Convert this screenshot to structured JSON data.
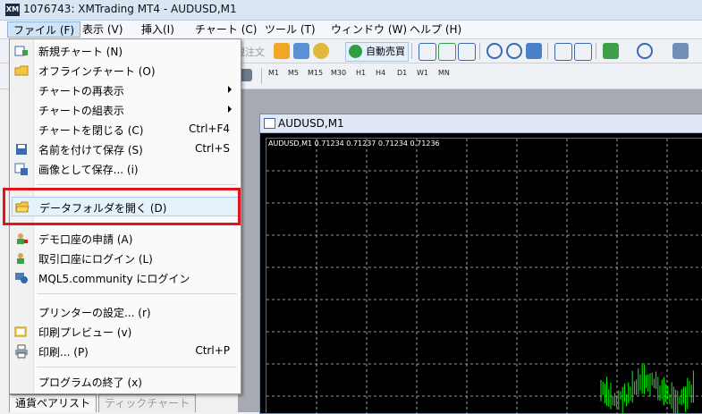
{
  "window": {
    "title": "1076743: XMTrading MT4 - AUDUSD,M1",
    "logo": "XM"
  },
  "menubar": {
    "items": [
      "ファイル (F)",
      "表示 (V)",
      "挿入(I)",
      "チャート (C)",
      "ツール (T)",
      "ウィンドウ (W)",
      "ヘルプ (H)"
    ]
  },
  "toolbar": {
    "new_order_label": "規注文",
    "autotrade_label": "自動売買",
    "timeframes": [
      "M1",
      "M5",
      "M15",
      "M30",
      "H1",
      "H4",
      "D1",
      "W1",
      "MN"
    ]
  },
  "file_menu": {
    "items": [
      {
        "label": "新規チャート (N)",
        "icon": "new-chart-icon",
        "shortcut": "",
        "submenu": false
      },
      {
        "label": "オフラインチャート (O)",
        "icon": "offline-chart-icon",
        "shortcut": "",
        "submenu": false
      },
      {
        "label": "チャートの再表示",
        "icon": "",
        "shortcut": "",
        "submenu": true
      },
      {
        "label": "チャートの組表示",
        "icon": "",
        "shortcut": "",
        "submenu": true
      },
      {
        "label": "チャートを閉じる (C)",
        "icon": "",
        "shortcut": "Ctrl+F4",
        "submenu": false
      },
      {
        "label": "名前を付けて保存 (S)",
        "icon": "save-icon",
        "shortcut": "Ctrl+S",
        "submenu": false
      },
      {
        "label": "画像として保存... (i)",
        "icon": "save-image-icon",
        "shortcut": "",
        "submenu": false
      },
      {
        "label": "データフォルダを開く (D)",
        "icon": "open-folder-icon",
        "shortcut": "",
        "submenu": false
      },
      {
        "label": "デモ口座の申請 (A)",
        "icon": "demo-account-icon",
        "shortcut": "",
        "submenu": false
      },
      {
        "label": "取引口座にログイン (L)",
        "icon": "login-account-icon",
        "shortcut": "",
        "submenu": false
      },
      {
        "label": "MQL5.community にログイン",
        "icon": "mql5-login-icon",
        "shortcut": "",
        "submenu": false
      },
      {
        "label": "プリンターの設定... (r)",
        "icon": "",
        "shortcut": "",
        "submenu": false
      },
      {
        "label": "印刷プレビュー (v)",
        "icon": "print-preview-icon",
        "shortcut": "",
        "submenu": false
      },
      {
        "label": "印刷... (P)",
        "icon": "print-icon",
        "shortcut": "Ctrl+P",
        "submenu": false
      },
      {
        "label": "プログラムの終了 (x)",
        "icon": "",
        "shortcut": "",
        "submenu": false
      }
    ]
  },
  "chart": {
    "window_title": "AUDUSD,M1",
    "info": "AUDUSD,M1  0.71234 0.71237 0.71234 0.71236"
  },
  "bottom_tabs": [
    "通貨ペアリスト",
    "ティックチャート"
  ],
  "colors": {
    "highlight_box": "#e3131c",
    "chart_bg": "#000000",
    "grid": "#c8c8c8",
    "candle": "#00ff00"
  }
}
